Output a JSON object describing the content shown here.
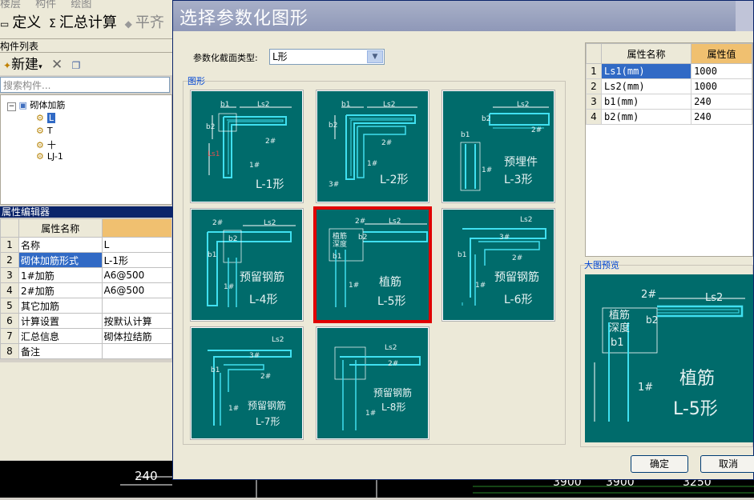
{
  "app": {
    "menu_ghost": [
      "楼层",
      "构件",
      "绘图"
    ],
    "toolbar": {
      "define_label": "定义",
      "summary_label": "汇总计算",
      "ping_label": "平齐"
    },
    "component_list_title": "构件列表",
    "new_label": "新建",
    "search_placeholder": "搜索构件...",
    "tree": {
      "root": "砌体加筋",
      "items": [
        "L",
        "T",
        "十",
        "LJ-1"
      ]
    },
    "property_editor": {
      "title": "属性编辑器",
      "header_name": "属性名称",
      "rows": [
        {
          "num": "1",
          "name": "名称",
          "value": "L"
        },
        {
          "num": "2",
          "name": "砌体加筋形式",
          "value": "L-1形"
        },
        {
          "num": "3",
          "name": "1#加筋",
          "value": "A6@500"
        },
        {
          "num": "4",
          "name": "2#加筋",
          "value": "A6@500"
        },
        {
          "num": "5",
          "name": "其它加筋",
          "value": ""
        },
        {
          "num": "6",
          "name": "计算设置",
          "value": "按默认计算"
        },
        {
          "num": "7",
          "name": "汇总信息",
          "value": "砌体拉结筋"
        },
        {
          "num": "8",
          "name": "备注",
          "value": ""
        }
      ]
    },
    "canvas_dims": {
      "d240": "240",
      "d3900a": "3900",
      "d3900b": "3900",
      "d3250": "3250"
    }
  },
  "dialog": {
    "title": "选择参数化图形",
    "type_label": "参数化截面类型:",
    "type_value": "L形",
    "shape_group_label": "图形",
    "shapes": [
      {
        "id": "L-1",
        "line1": "L-1形",
        "line2": ""
      },
      {
        "id": "L-2",
        "line1": "L-2形",
        "line2": ""
      },
      {
        "id": "L-3",
        "line1": "预埋件",
        "line2": "L-3形"
      },
      {
        "id": "L-4",
        "line1": "预留钢筋",
        "line2": "L-4形"
      },
      {
        "id": "L-5",
        "line1": "植筋",
        "line2": "L-5形"
      },
      {
        "id": "L-6",
        "line1": "预留钢筋",
        "line2": "L-6形"
      },
      {
        "id": "L-7",
        "line1": "预留钢筋",
        "line2": "L-7形"
      },
      {
        "id": "L-8",
        "line1": "预留钢筋",
        "line2": "L-8形"
      }
    ],
    "thumb_marks": {
      "b1": "b1",
      "b2": "b2",
      "ls1": "Ls1",
      "ls2": "Ls2",
      "bar1": "1#",
      "bar2": "2#",
      "bar3": "3#",
      "depth1": "植筋",
      "depth2": "深度"
    },
    "selected_shape": "L-5",
    "attr_table": {
      "header_name": "属性名称",
      "header_value": "属性值",
      "rows": [
        {
          "num": "1",
          "name": "Ls1(mm)",
          "value": "1000"
        },
        {
          "num": "2",
          "name": "Ls2(mm)",
          "value": "1000"
        },
        {
          "num": "3",
          "name": "b1(mm)",
          "value": "240"
        },
        {
          "num": "4",
          "name": "b2(mm)",
          "value": "240"
        }
      ]
    },
    "preview_label": "大图预览",
    "preview_text1": "植筋",
    "preview_text2": "L-5形",
    "ok_label": "确定",
    "cancel_label": "取消"
  },
  "colors": {
    "thumb_bg": "#006b6b",
    "rebar": "#40e0f0",
    "selected_border": "#e00000"
  }
}
